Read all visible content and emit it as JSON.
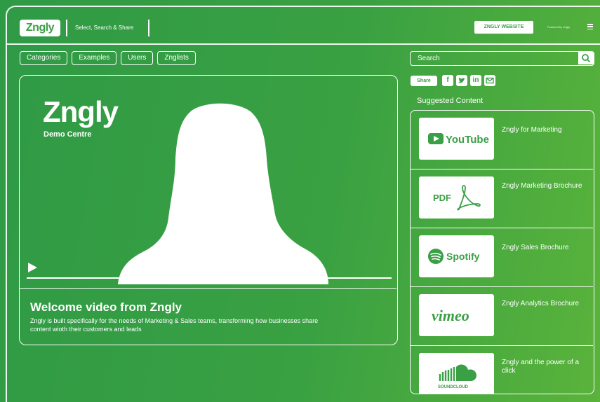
{
  "header": {
    "logo": "Zngly",
    "tagline": "Select, Search & Share",
    "website_button": "ZNGLY WEBSITE",
    "small_link": "Powered by Zngly"
  },
  "nav": {
    "items": [
      {
        "label": "Categories"
      },
      {
        "label": "Examples"
      },
      {
        "label": "Users"
      },
      {
        "label": "Znglists"
      }
    ]
  },
  "search": {
    "placeholder": "Search"
  },
  "video": {
    "brand": "Zngly",
    "subtitle": "Demo Centre",
    "title": "Welcome video from Zngly",
    "description": "Zngly is built specifically for the needs of Marketing & Sales teams, transforming how businesses share content wioth their customers and leads"
  },
  "share": {
    "label": "Share",
    "icons": [
      "facebook-icon",
      "twitter-icon",
      "linkedin-icon",
      "email-icon"
    ]
  },
  "suggested": {
    "title": "Suggested Content",
    "items": [
      {
        "label": "Zngly for Marketing",
        "thumb": "YouTube"
      },
      {
        "label": "Zngly Marketing Brochure",
        "thumb": "PDF"
      },
      {
        "label": "Zngly Sales Brochure",
        "thumb": "Spotify"
      },
      {
        "label": "Zngly Analytics Brochure",
        "thumb": "vimeo"
      },
      {
        "label": "Zngly and the power of a click",
        "thumb": "SOUNDCLOUD"
      }
    ]
  },
  "colors": {
    "accent": "#3a9f45",
    "background": "#3aa142",
    "foreground": "#ffffff"
  }
}
